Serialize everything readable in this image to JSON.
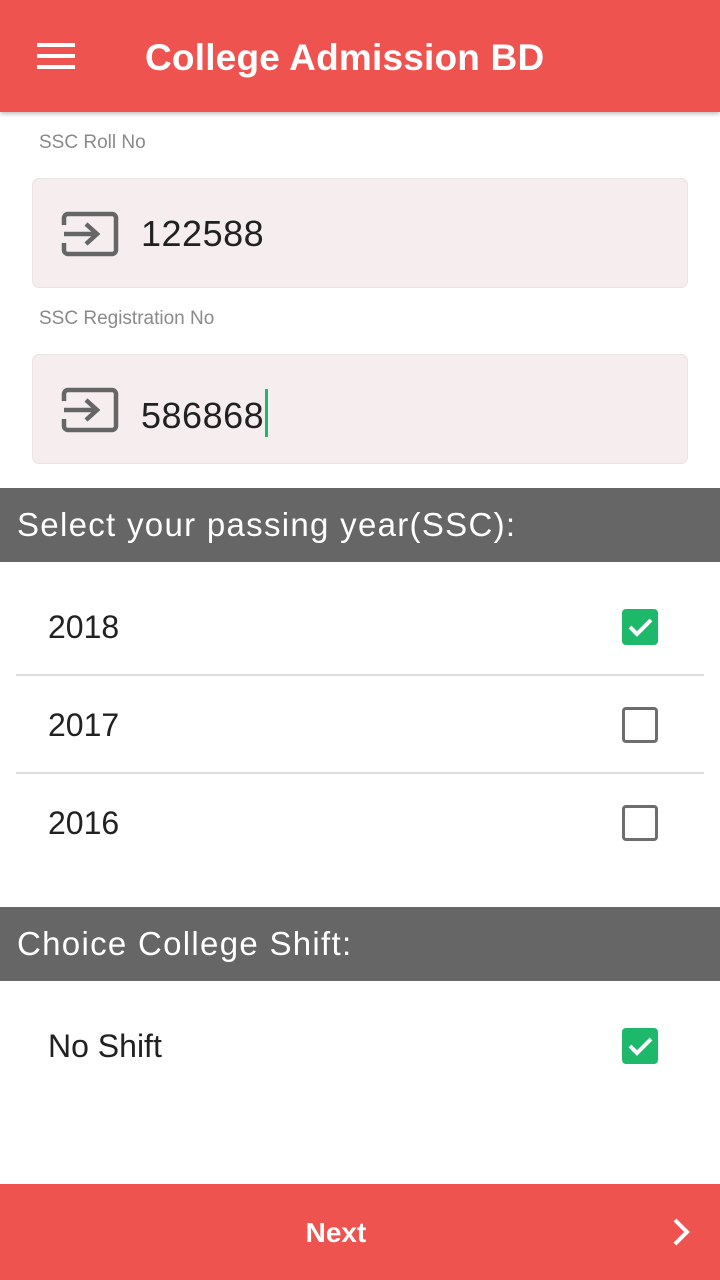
{
  "appbar": {
    "title": "College Admission BD",
    "menu_icon": "hamburger-menu-icon",
    "color": "#ef5350"
  },
  "fields": {
    "roll": {
      "label": "SSC Roll No",
      "value": "122588",
      "icon": "input-arrow-icon"
    },
    "registration": {
      "label": "SSC Registration No",
      "value": "586868",
      "icon": "input-arrow-icon"
    }
  },
  "passing_year": {
    "header": "Select your passing year(SSC):",
    "options": [
      {
        "label": "2018",
        "checked": true
      },
      {
        "label": "2017",
        "checked": false
      },
      {
        "label": "2016",
        "checked": false
      }
    ]
  },
  "shift": {
    "header": "Choice College Shift:",
    "options": [
      {
        "label": "No Shift",
        "checked": true
      }
    ]
  },
  "footer": {
    "next_label": "Next",
    "next_icon": "chevron-right-icon"
  },
  "colors": {
    "accent": "#ef5350",
    "check": "#1db86a",
    "section_header": "#666666",
    "input_bg": "#f5edee"
  }
}
